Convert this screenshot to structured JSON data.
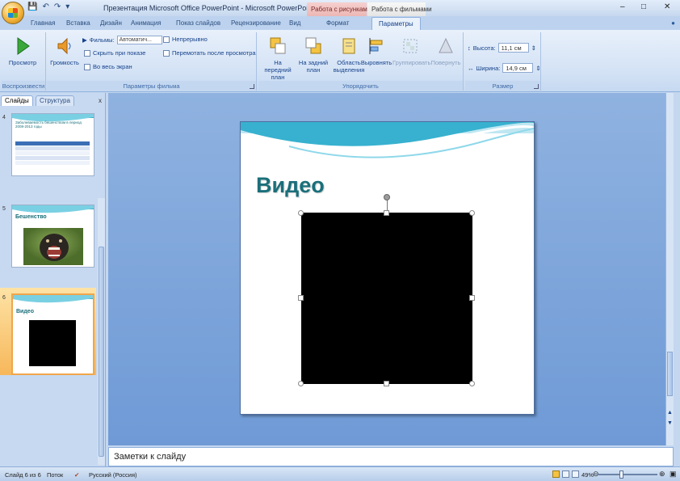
{
  "window": {
    "title": "Презентация Microsoft Office PowerPoint - Microsoft PowerPoint",
    "context_tab_picture": "Работа с рисунками",
    "context_tab_video": "Работа с фильмами",
    "min": "–",
    "max": "□",
    "close": "✕"
  },
  "tabs": [
    "Главная",
    "Вставка",
    "Дизайн",
    "Анимация",
    "Показ слайдов",
    "Рецензирование",
    "Вид",
    "Формат",
    "Параметры"
  ],
  "ribbon": {
    "play": {
      "button": "Просмотр",
      "group": "Воспроизвести"
    },
    "movie_options": {
      "volume": "Громкость",
      "slides_label": "Фильмы:",
      "slides_value": "Автоматич...",
      "hide": "Скрыть при показе",
      "fullscreen": "Во весь экран",
      "loop": "Непрерывно",
      "rewind": "Перемотать после просмотра",
      "group": "Параметры фильма"
    },
    "arrange": {
      "bring_front": "На передний план",
      "send_back": "На задний план",
      "selection_pane": "Область выделения",
      "align": "Выровнять",
      "group_btn": "Группировать",
      "rotate": "Повернуть",
      "group": "Упорядочить"
    },
    "size": {
      "height_label": "Высота:",
      "height_value": "11,1 см",
      "width_label": "Ширина:",
      "width_value": "14,9 см",
      "group": "Размер"
    }
  },
  "pane": {
    "tab_slides": "Слайды",
    "tab_outline": "Структура",
    "close": "x",
    "thumbs": [
      {
        "num": "4",
        "title": "Заболеваемость бешенством в период 2008-2013 годы"
      },
      {
        "num": "5",
        "title": "Бешенство"
      },
      {
        "num": "6",
        "title": "Видео"
      }
    ]
  },
  "slide": {
    "title": "Видео"
  },
  "notes": {
    "placeholder": "Заметки к слайду"
  },
  "status": {
    "slide_info": "Слайд 6 из 6",
    "theme": "Поток",
    "language": "Русский (Россия)",
    "zoom": "49%"
  },
  "colors": {
    "ribbon_bg": "#d3e2f5",
    "title_teal": "#1a6f7a",
    "selection_orange": "#f7b75a"
  }
}
